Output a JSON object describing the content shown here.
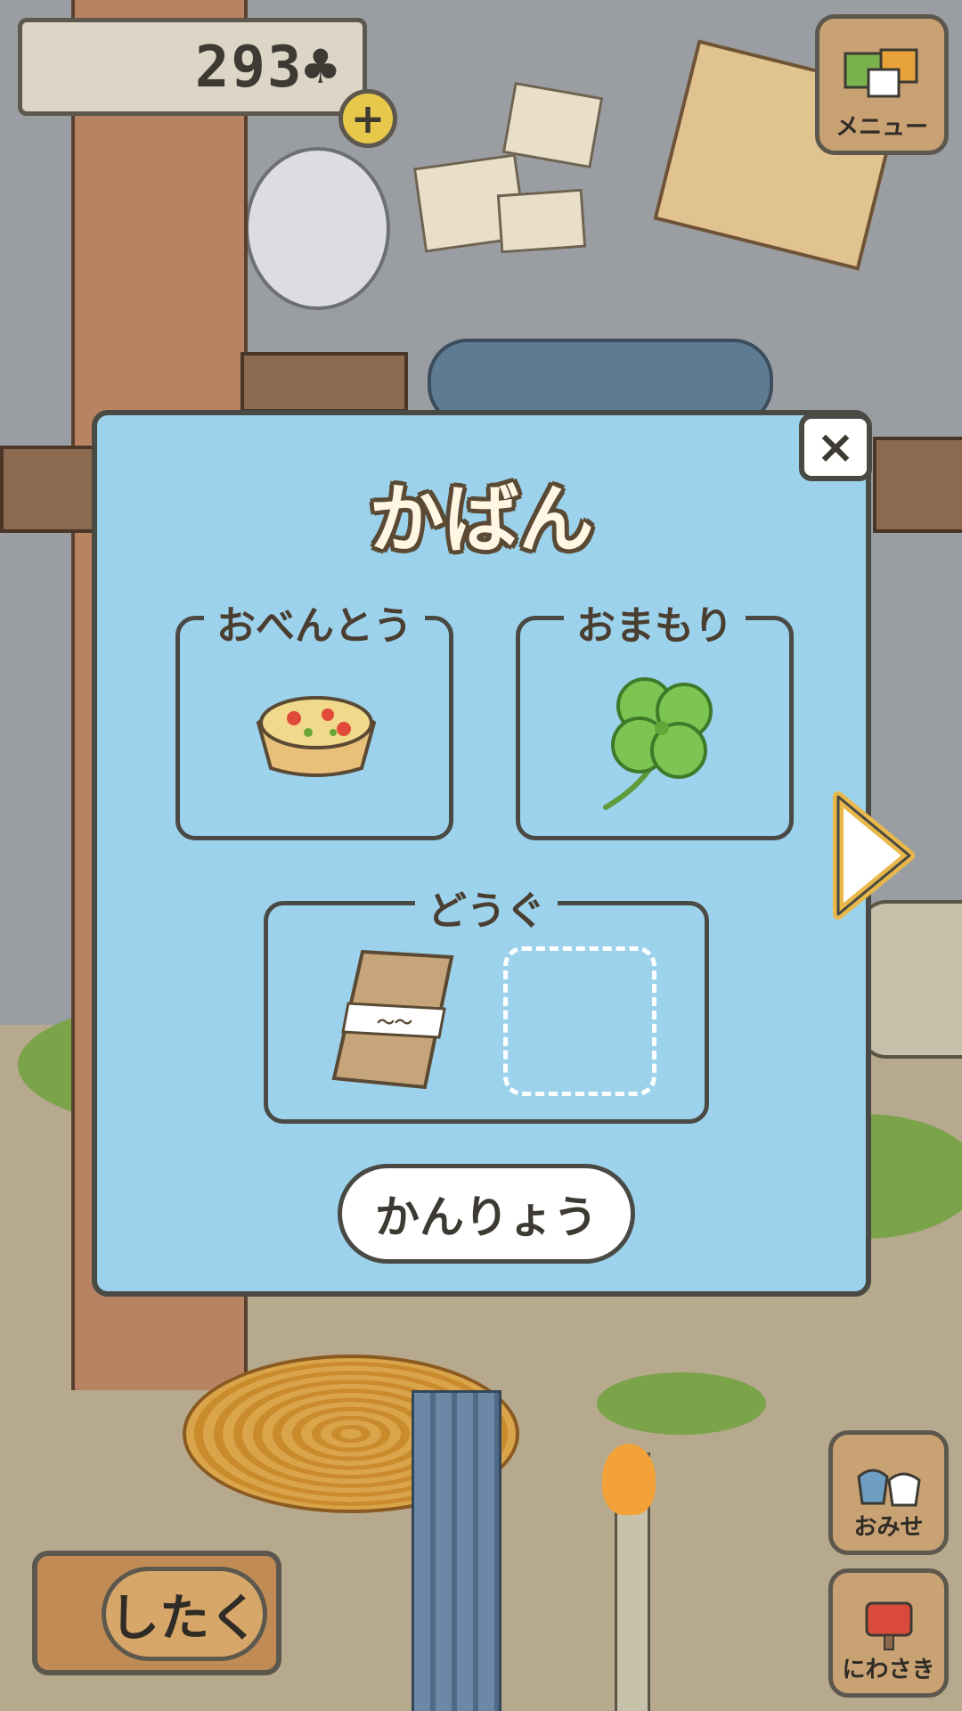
{
  "hud": {
    "currency_value": "293",
    "currency_icon": "clover-icon",
    "plus_label": "+",
    "menu_label": "メニュー"
  },
  "modal": {
    "title": "かばん",
    "close_label": "×",
    "sections": {
      "lunch": {
        "label": "おべんとう",
        "item_icon": "quiche-icon"
      },
      "charm": {
        "label": "おまもり",
        "item_icon": "four-leaf-clover-icon"
      },
      "tools": {
        "label": "どうぐ",
        "item_icon": "tenugui-cloth-icon",
        "empty_slot_icon": "empty-slot"
      }
    },
    "done_label": "かんりょう",
    "next_icon": "next-arrow-icon"
  },
  "bottom_bar": {
    "shitaku_label": "したく",
    "shop_label": "おみせ",
    "garden_label": "にわさき"
  },
  "colors": {
    "modal_bg": "#9dd2ec",
    "outline": "#4a4a44",
    "arrow_fill": "#ffffff",
    "arrow_border": "#e8b84a"
  }
}
